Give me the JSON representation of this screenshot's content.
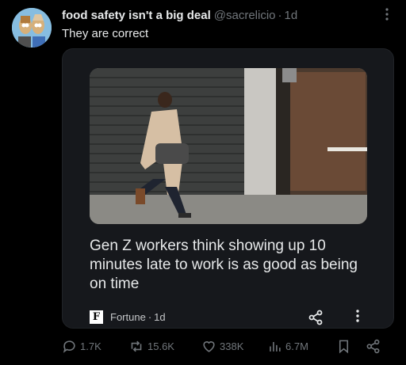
{
  "tweet": {
    "display_name": "food safety isn't a big deal",
    "handle": "@sacrelicio",
    "separator": "·",
    "time": "1d",
    "text": "They are correct",
    "more_icon": "ellipsis-vertical-icon"
  },
  "card": {
    "title": "Gen Z workers think showing up 10 minutes late to work is as good as being on time",
    "source_name": "Fortune",
    "source_time": "1d",
    "source_separator": "·",
    "logo_letter": "F",
    "share_icon": "share-icon",
    "more_icon": "ellipsis-vertical-icon"
  },
  "actions": {
    "replies": "1.7K",
    "reposts": "15.6K",
    "likes": "338K",
    "views": "6.7M"
  },
  "colors": {
    "background": "#000000",
    "text": "#e7e9ea",
    "muted": "#71767b",
    "card": "#16181c"
  }
}
